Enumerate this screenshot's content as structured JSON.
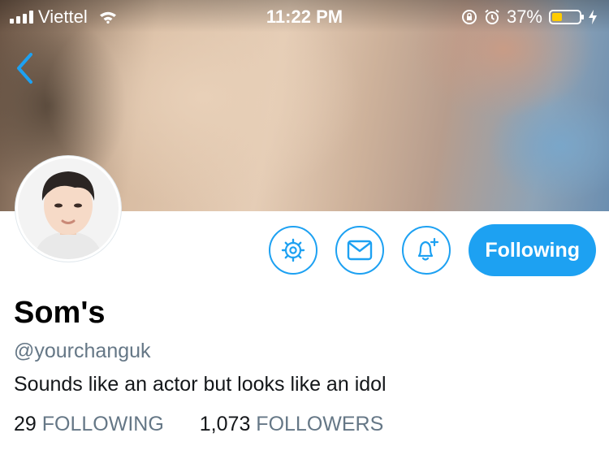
{
  "status_bar": {
    "carrier": "Viettel",
    "time": "11:22 PM",
    "battery_percent": "37%",
    "battery_level": 0.37,
    "battery_color": "#ffcc00"
  },
  "header": {
    "back_icon": "chevron-left-icon"
  },
  "profile": {
    "display_name": "Som's",
    "handle": "@yourchanguk",
    "bio": "Sounds like an actor but looks like an idol",
    "following_count": "29",
    "following_label": "FOLLOWING",
    "followers_count": "1,073",
    "followers_label": "FOLLOWERS"
  },
  "actions": {
    "settings_icon": "gear-icon",
    "message_icon": "envelope-icon",
    "notify_icon": "bell-plus-icon",
    "follow_label": "Following"
  },
  "colors": {
    "accent": "#1da1f2",
    "secondary_text": "#657786",
    "primary_text": "#14171a"
  }
}
